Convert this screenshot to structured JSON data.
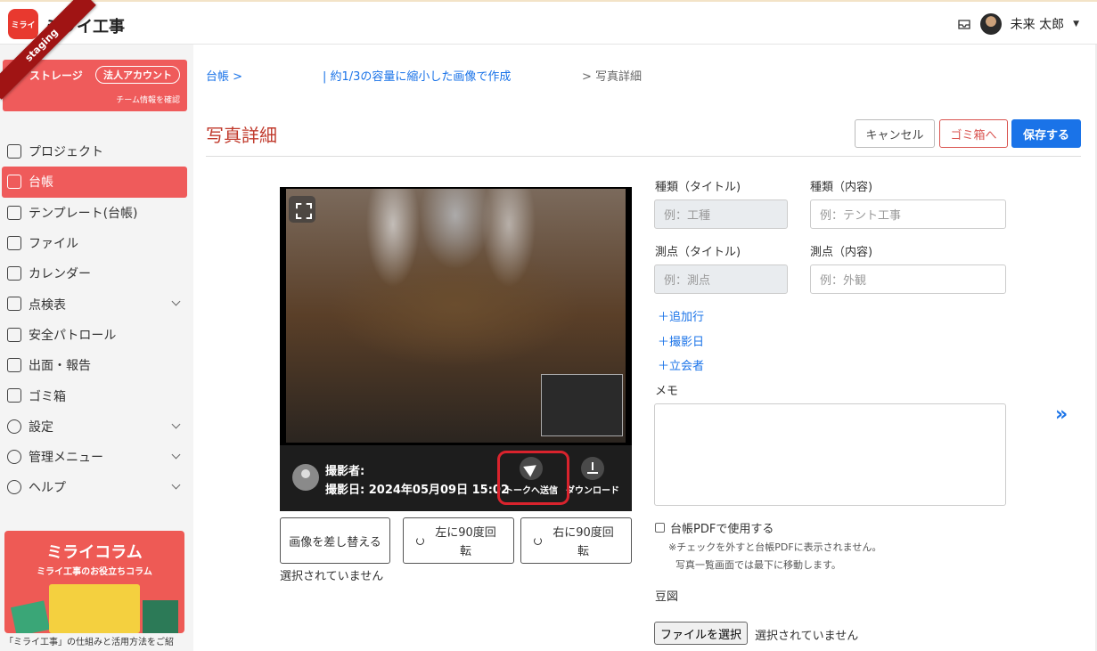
{
  "app": {
    "brand_logo_text": "ミライ",
    "brand_name": "ミライ工事",
    "env_ribbon": "staging"
  },
  "header": {
    "user_name": "未来 太郎"
  },
  "sidebar": {
    "storage_label": "ストレージ",
    "corp_badge": "法人アカウント",
    "team_link": "チーム情報を確認",
    "items": [
      {
        "label": "プロジェクト",
        "icon": "headset-icon",
        "expandable": false
      },
      {
        "label": "台帳",
        "icon": "album-icon",
        "expandable": false,
        "active": true
      },
      {
        "label": "テンプレート(台帳)",
        "icon": "template-icon",
        "expandable": false
      },
      {
        "label": "ファイル",
        "icon": "file-icon",
        "expandable": false
      },
      {
        "label": "カレンダー",
        "icon": "calendar-icon",
        "expandable": false
      },
      {
        "label": "点検表",
        "icon": "checklist-icon",
        "expandable": true
      },
      {
        "label": "安全パトロール",
        "icon": "patrol-icon",
        "expandable": false
      },
      {
        "label": "出面・報告",
        "icon": "report-icon",
        "expandable": false
      },
      {
        "label": "ゴミ箱",
        "icon": "trash-icon",
        "expandable": false
      },
      {
        "label": "設定",
        "icon": "gear-icon",
        "expandable": true
      },
      {
        "label": "管理メニュー",
        "icon": "admin-icon",
        "expandable": true
      },
      {
        "label": "ヘルプ",
        "icon": "help-icon",
        "expandable": true
      }
    ],
    "banner_title": "ミライコラム",
    "banner_sub": "ミライ工事のお役立ちコラム",
    "banner_caption": "「ミライ工事」の仕組みと活用方法をご紹"
  },
  "breadcrumb": {
    "home": "台帳 >",
    "album": "| 約1/3の容量に縮小した画像で作成",
    "current": "> 写真詳細"
  },
  "page": {
    "title": "写真詳細",
    "cancel": "キャンセル",
    "trash": "ゴミ箱へ",
    "save": "保存する"
  },
  "photo": {
    "photographer": "撮影者:",
    "taken_at": "撮影日: 2024年05月09日 15:02",
    "send_to_talk": "トークへ送信",
    "download": "ダウンロード",
    "replace": "画像を差し替える",
    "rotate_left": "左に90度回転",
    "rotate_right": "右に90度回転",
    "no_file": "選択されていません"
  },
  "form": {
    "type_title_label": "種類（タイトル)",
    "type_title_placeholder": "例：工種",
    "type_content_label": "種類（内容)",
    "type_content_placeholder": "例：テント工事",
    "point_title_label": "測点（タイトル)",
    "point_title_placeholder": "例：測点",
    "point_content_label": "測点（内容)",
    "point_content_placeholder": "例：外観",
    "add_row": "＋追加行",
    "add_date": "＋撮影日",
    "add_witness": "＋立会者",
    "memo_label": "メモ",
    "use_pdf_label": "台帳PDFで使用する",
    "note_1": "※チェックを外すと台帳PDFに表示されません。",
    "note_2": "写真一覧画面では最下に移動します。",
    "sketch_label": "豆図",
    "file_button": "ファイルを選択",
    "file_none": "選択されていません"
  }
}
